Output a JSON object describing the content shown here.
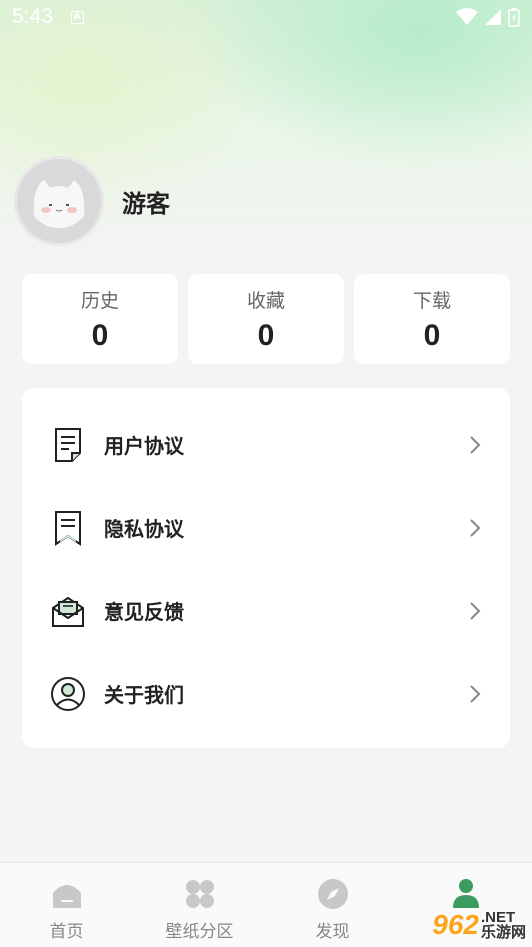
{
  "status_bar": {
    "time": "5:43",
    "notif_letter": "A"
  },
  "profile": {
    "username": "游客"
  },
  "stats": [
    {
      "label": "历史",
      "value": "0"
    },
    {
      "label": "收藏",
      "value": "0"
    },
    {
      "label": "下载",
      "value": "0"
    }
  ],
  "menu": [
    {
      "label": "用户协议",
      "icon": "document-icon"
    },
    {
      "label": "隐私协议",
      "icon": "bookmark-document-icon"
    },
    {
      "label": "意见反馈",
      "icon": "mail-icon"
    },
    {
      "label": "关于我们",
      "icon": "user-circle-icon"
    }
  ],
  "tabs": [
    {
      "label": "首页",
      "icon": "home-icon"
    },
    {
      "label": "壁纸分区",
      "icon": "grid-petals-icon"
    },
    {
      "label": "发现",
      "icon": "compass-icon"
    },
    {
      "label": "",
      "icon": "profile-icon",
      "active": true
    }
  ],
  "watermark": {
    "number": "962",
    "net": ".NET",
    "cn": "乐游网"
  },
  "colors": {
    "accent_green": "#3c9b5f",
    "watermark_orange": "#ffa21c"
  }
}
